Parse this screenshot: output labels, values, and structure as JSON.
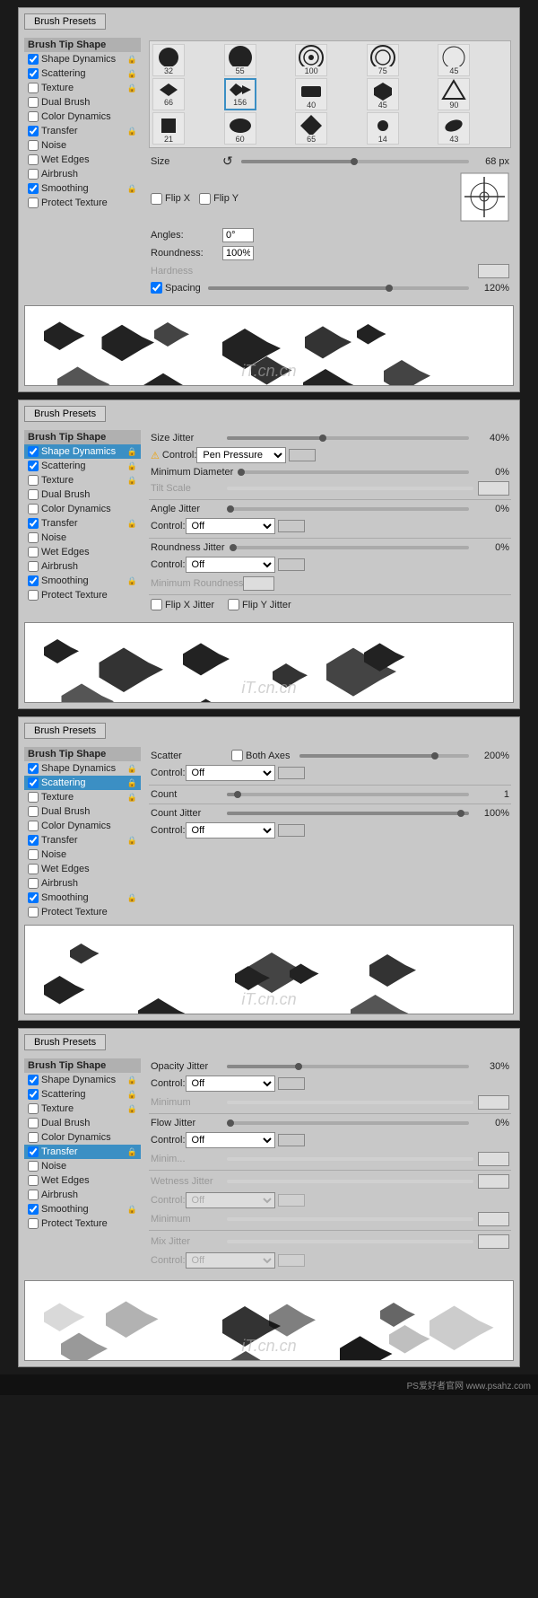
{
  "panels": [
    {
      "id": "brush-tip",
      "brushPresetsLabel": "Brush Presets",
      "activeSection": "Brush Tip Shape",
      "sidebar": [
        {
          "label": "Brush Tip Shape",
          "checked": null,
          "active": false,
          "isHeader": true,
          "hasLock": false
        },
        {
          "label": "Shape Dynamics",
          "checked": true,
          "active": false,
          "isHeader": false,
          "hasLock": true
        },
        {
          "label": "Scattering",
          "checked": true,
          "active": false,
          "isHeader": false,
          "hasLock": true
        },
        {
          "label": "Texture",
          "checked": false,
          "active": false,
          "isHeader": false,
          "hasLock": true
        },
        {
          "label": "Dual Brush",
          "checked": false,
          "active": false,
          "isHeader": false,
          "hasLock": false
        },
        {
          "label": "Color Dynamics",
          "checked": false,
          "active": false,
          "isHeader": false,
          "hasLock": false
        },
        {
          "label": "Transfer",
          "checked": true,
          "active": false,
          "isHeader": false,
          "hasLock": true
        },
        {
          "label": "Noise",
          "checked": false,
          "active": false,
          "isHeader": false,
          "hasLock": false
        },
        {
          "label": "Wet Edges",
          "checked": false,
          "active": false,
          "isHeader": false,
          "hasLock": false
        },
        {
          "label": "Airbrush",
          "checked": false,
          "active": false,
          "isHeader": false,
          "hasLock": false
        },
        {
          "label": "Smoothing",
          "checked": true,
          "active": false,
          "isHeader": false,
          "hasLock": true
        },
        {
          "label": "Protect Texture",
          "checked": false,
          "active": false,
          "isHeader": false,
          "hasLock": false
        }
      ],
      "controls": {
        "size": "68 px",
        "flipX": false,
        "flipY": false,
        "angle": "0°",
        "roundness": "100%",
        "spacing": "120%",
        "spacingChecked": true
      }
    },
    {
      "id": "shape-dynamics",
      "brushPresetsLabel": "Brush Presets",
      "activeSection": "Shape Dynamics",
      "sidebar": [
        {
          "label": "Brush Tip Shape",
          "checked": null,
          "active": false,
          "isHeader": true,
          "hasLock": false
        },
        {
          "label": "Shape Dynamics",
          "checked": true,
          "active": true,
          "isHeader": false,
          "hasLock": true
        },
        {
          "label": "Scattering",
          "checked": true,
          "active": false,
          "isHeader": false,
          "hasLock": true
        },
        {
          "label": "Texture",
          "checked": false,
          "active": false,
          "isHeader": false,
          "hasLock": true
        },
        {
          "label": "Dual Brush",
          "checked": false,
          "active": false,
          "isHeader": false,
          "hasLock": false
        },
        {
          "label": "Color Dynamics",
          "checked": false,
          "active": false,
          "isHeader": false,
          "hasLock": false
        },
        {
          "label": "Transfer",
          "checked": true,
          "active": false,
          "isHeader": false,
          "hasLock": true
        },
        {
          "label": "Noise",
          "checked": false,
          "active": false,
          "isHeader": false,
          "hasLock": false
        },
        {
          "label": "Wet Edges",
          "checked": false,
          "active": false,
          "isHeader": false,
          "hasLock": false
        },
        {
          "label": "Airbrush",
          "checked": false,
          "active": false,
          "isHeader": false,
          "hasLock": false
        },
        {
          "label": "Smoothing",
          "checked": true,
          "active": false,
          "isHeader": false,
          "hasLock": true
        },
        {
          "label": "Protect Texture",
          "checked": false,
          "active": false,
          "isHeader": false,
          "hasLock": false
        }
      ],
      "controls": {
        "sizeJitter": "40%",
        "controlLabel": "Control:",
        "controlValue": "Pen Pressure",
        "minDiameter": "0%",
        "tiltScale": "",
        "angleJitter": "0%",
        "angleControl": "Off",
        "roundnessJitter": "0%",
        "roundnessControl": "Off",
        "minRoundness": "",
        "flipXJitter": false,
        "flipYJitter": false
      }
    },
    {
      "id": "scattering",
      "brushPresetsLabel": "Brush Presets",
      "activeSection": "Scattering",
      "sidebar": [
        {
          "label": "Brush Tip Shape",
          "checked": null,
          "active": false,
          "isHeader": true,
          "hasLock": false
        },
        {
          "label": "Shape Dynamics",
          "checked": true,
          "active": false,
          "isHeader": false,
          "hasLock": true
        },
        {
          "label": "Scattering",
          "checked": true,
          "active": true,
          "isHeader": false,
          "hasLock": true
        },
        {
          "label": "Texture",
          "checked": false,
          "active": false,
          "isHeader": false,
          "hasLock": true
        },
        {
          "label": "Dual Brush",
          "checked": false,
          "active": false,
          "isHeader": false,
          "hasLock": false
        },
        {
          "label": "Color Dynamics",
          "checked": false,
          "active": false,
          "isHeader": false,
          "hasLock": false
        },
        {
          "label": "Transfer",
          "checked": true,
          "active": false,
          "isHeader": false,
          "hasLock": true
        },
        {
          "label": "Noise",
          "checked": false,
          "active": false,
          "isHeader": false,
          "hasLock": false
        },
        {
          "label": "Wet Edges",
          "checked": false,
          "active": false,
          "isHeader": false,
          "hasLock": false
        },
        {
          "label": "Airbrush",
          "checked": false,
          "active": false,
          "isHeader": false,
          "hasLock": false
        },
        {
          "label": "Smoothing",
          "checked": true,
          "active": false,
          "isHeader": false,
          "hasLock": true
        },
        {
          "label": "Protect Texture",
          "checked": false,
          "active": false,
          "isHeader": false,
          "hasLock": false
        }
      ],
      "controls": {
        "scatter": "200%",
        "bothAxes": false,
        "scatterControl": "Off",
        "count": "1",
        "countJitter": "100%",
        "countJitterControl": "Off"
      }
    },
    {
      "id": "transfer",
      "brushPresetsLabel": "Brush Presets",
      "activeSection": "Transfer",
      "sidebar": [
        {
          "label": "Brush Tip Shape",
          "checked": null,
          "active": false,
          "isHeader": true,
          "hasLock": false
        },
        {
          "label": "Shape Dynamics",
          "checked": true,
          "active": false,
          "isHeader": false,
          "hasLock": true
        },
        {
          "label": "Scattering",
          "checked": true,
          "active": false,
          "isHeader": false,
          "hasLock": true
        },
        {
          "label": "Texture",
          "checked": false,
          "active": false,
          "isHeader": false,
          "hasLock": true
        },
        {
          "label": "Dual Brush",
          "checked": false,
          "active": false,
          "isHeader": false,
          "hasLock": false
        },
        {
          "label": "Color Dynamics",
          "checked": false,
          "active": false,
          "isHeader": false,
          "hasLock": false
        },
        {
          "label": "Transfer",
          "checked": true,
          "active": true,
          "isHeader": false,
          "hasLock": true
        },
        {
          "label": "Noise",
          "checked": false,
          "active": false,
          "isHeader": false,
          "hasLock": false
        },
        {
          "label": "Wet Edges",
          "checked": false,
          "active": false,
          "isHeader": false,
          "hasLock": false
        },
        {
          "label": "Airbrush",
          "checked": false,
          "active": false,
          "isHeader": false,
          "hasLock": false
        },
        {
          "label": "Smoothing",
          "checked": true,
          "active": false,
          "isHeader": false,
          "hasLock": true
        },
        {
          "label": "Protect Texture",
          "checked": false,
          "active": false,
          "isHeader": false,
          "hasLock": false
        }
      ],
      "controls": {
        "opacityJitter": "30%",
        "opacityControl": "Off",
        "opacityMin": "",
        "flowJitter": "0%",
        "flowControl": "Off",
        "flowMin": "",
        "wetnessJitter": "",
        "wetnessControl": "Off",
        "wetnessMin": "",
        "mixJitter": "",
        "mixControl": "Off"
      }
    }
  ],
  "brushSizes": [
    {
      "size": 32
    },
    {
      "size": 55
    },
    {
      "size": 100
    },
    {
      "size": 75
    },
    {
      "size": 45
    },
    {
      "size": 66
    },
    {
      "size": 156
    },
    {
      "size": 40
    },
    {
      "size": 45
    },
    {
      "size": 90
    },
    {
      "size": 21
    },
    {
      "size": 60
    },
    {
      "size": 65
    },
    {
      "size": 14
    },
    {
      "size": 43
    }
  ]
}
